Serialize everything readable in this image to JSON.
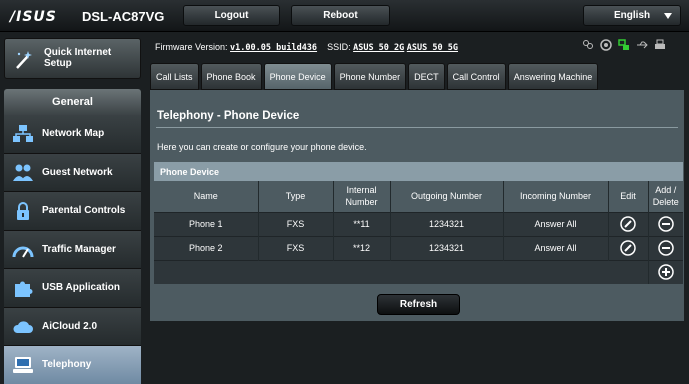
{
  "header": {
    "logo": "/ISUS",
    "model": "DSL-AC87VG",
    "logout_label": "Logout",
    "reboot_label": "Reboot",
    "language": "English"
  },
  "sidebar": {
    "quick_setup": "Quick Internet Setup",
    "section_title": "General",
    "items": [
      {
        "label": "Network Map",
        "icon": "network-map-icon"
      },
      {
        "label": "Guest Network",
        "icon": "guest-network-icon"
      },
      {
        "label": "Parental Controls",
        "icon": "lock-icon"
      },
      {
        "label": "Traffic Manager",
        "icon": "speedometer-icon"
      },
      {
        "label": "USB Application",
        "icon": "puzzle-icon"
      },
      {
        "label": "AiCloud 2.0",
        "icon": "cloud-icon"
      },
      {
        "label": "Telephony",
        "icon": "telephone-icon",
        "active": true
      }
    ]
  },
  "status": {
    "firmware_label": "Firmware Version:",
    "firmware_value": "v1.00.05_build436",
    "ssid_label": "SSID:",
    "ssid_1": "ASUS_50_2G",
    "ssid_2": "ASUS_50_5G"
  },
  "tabs": [
    {
      "label": "Call Lists"
    },
    {
      "label": "Phone Book"
    },
    {
      "label": "Phone Device",
      "active": true
    },
    {
      "label": "Phone Number"
    },
    {
      "label": "DECT"
    },
    {
      "label": "Call Control"
    },
    {
      "label": "Answering Machine"
    }
  ],
  "main": {
    "title": "Telephony - Phone Device",
    "description": "Here you can create or configure your phone device.",
    "table": {
      "caption": "Phone Device",
      "headers": [
        "Name",
        "Type",
        "Internal Number",
        "Outgoing Number",
        "Incoming Number",
        "Edit",
        "Add / Delete"
      ],
      "rows": [
        {
          "name": "Phone 1",
          "type": "FXS",
          "internal": "**11",
          "outgoing": "1234321",
          "incoming": "Answer All"
        },
        {
          "name": "Phone 2",
          "type": "FXS",
          "internal": "**12",
          "outgoing": "1234321",
          "incoming": "Answer All"
        }
      ]
    },
    "refresh_label": "Refresh"
  },
  "colors": {
    "panel": "#4d5b61",
    "table_header": "#8a9da7",
    "active_nav": "#8aa0b5"
  }
}
